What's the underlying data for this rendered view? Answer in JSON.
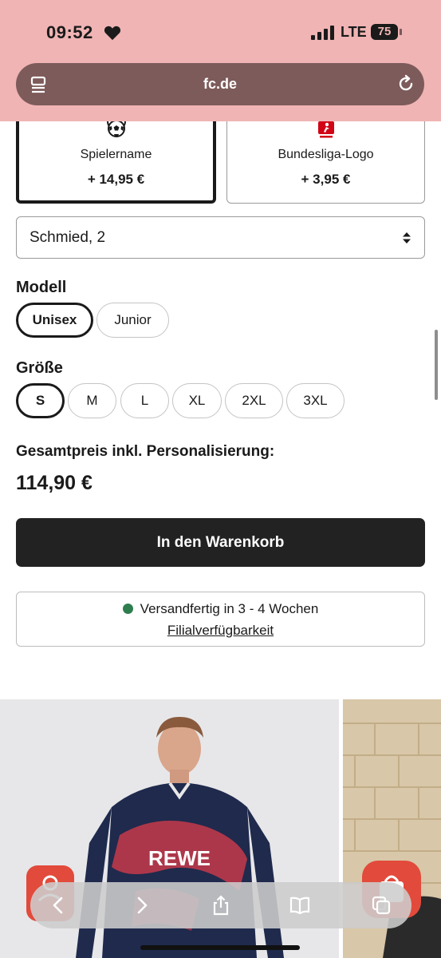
{
  "status_bar": {
    "time": "09:52",
    "network": "LTE",
    "battery": "75"
  },
  "browser": {
    "url": "fc.de"
  },
  "print_options": [
    {
      "label": "Spielername",
      "price": "+ 14,95 €",
      "icon": "soccer-ball-icon",
      "selected": true
    },
    {
      "label": "Bundesliga-Logo",
      "price": "+ 3,95 €",
      "icon": "bundesliga-logo-icon",
      "selected": false
    }
  ],
  "player_select": {
    "value": "Schmied, 2"
  },
  "model": {
    "label": "Modell",
    "options": [
      "Unisex",
      "Junior"
    ],
    "selected": "Unisex"
  },
  "size": {
    "label": "Größe",
    "options": [
      "S",
      "M",
      "L",
      "XL",
      "2XL",
      "3XL"
    ],
    "selected": "S"
  },
  "total": {
    "label": "Gesamtpreis inkl. Personalisierung:",
    "price": "114,90 €"
  },
  "cart_button": {
    "label": "In den Warenkorb"
  },
  "shipping": {
    "status": "Versandfertig in 3 - 4 Wochen",
    "status_color": "#2e7d4f",
    "link": "Filialverfügbarkeit"
  },
  "colors": {
    "topbar": "#f0b4b4",
    "urlbar": "#7d5b5a",
    "button": "#222222",
    "accent_red": "#e24a3b"
  }
}
